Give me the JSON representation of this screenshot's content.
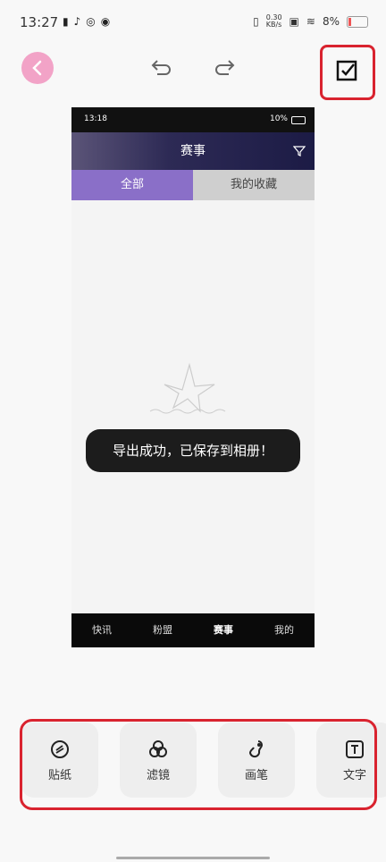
{
  "status_bar": {
    "time": "13:27",
    "net_speed": "0.30\nKB/s",
    "battery": "8%"
  },
  "toolbar": {},
  "preview": {
    "status_time": "13:18",
    "status_battery": "10%",
    "title": "赛事",
    "tabs": [
      "全部",
      "我的收藏"
    ],
    "toast": "导出成功，已保存到相册！",
    "nav": [
      "快讯",
      "粉盟",
      "赛事",
      "我的"
    ]
  },
  "tools": [
    {
      "label": "贴纸",
      "icon": "sticker-icon"
    },
    {
      "label": "滤镜",
      "icon": "filter-icon"
    },
    {
      "label": "画笔",
      "icon": "brush-icon"
    },
    {
      "label": "文字",
      "icon": "text-icon"
    }
  ],
  "colors": {
    "accent_red": "#d9232f",
    "back_pink": "#f2a3c7",
    "tab_purple": "#8a6fc8"
  }
}
